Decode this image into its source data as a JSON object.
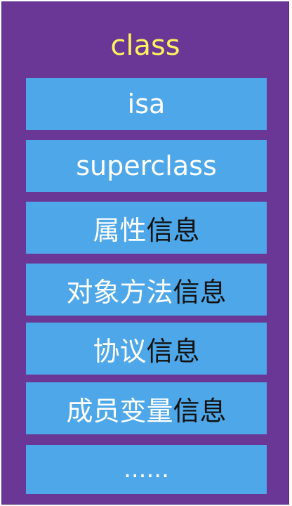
{
  "title": "class",
  "items": [
    {
      "white": "isa",
      "dark": ""
    },
    {
      "white": "superclass",
      "dark": ""
    },
    {
      "white": "属性",
      "dark": "信息"
    },
    {
      "white": "对象方法",
      "dark": "信息"
    },
    {
      "white": "协议",
      "dark": "信息"
    },
    {
      "white": "成员变量",
      "dark": "信息"
    },
    {
      "white": "......",
      "dark": ""
    }
  ],
  "colors": {
    "background": "#6a3796",
    "box": "#4ea7e8",
    "title": "#fff25c",
    "text_light": "#ffffff",
    "text_dark": "#111111"
  }
}
